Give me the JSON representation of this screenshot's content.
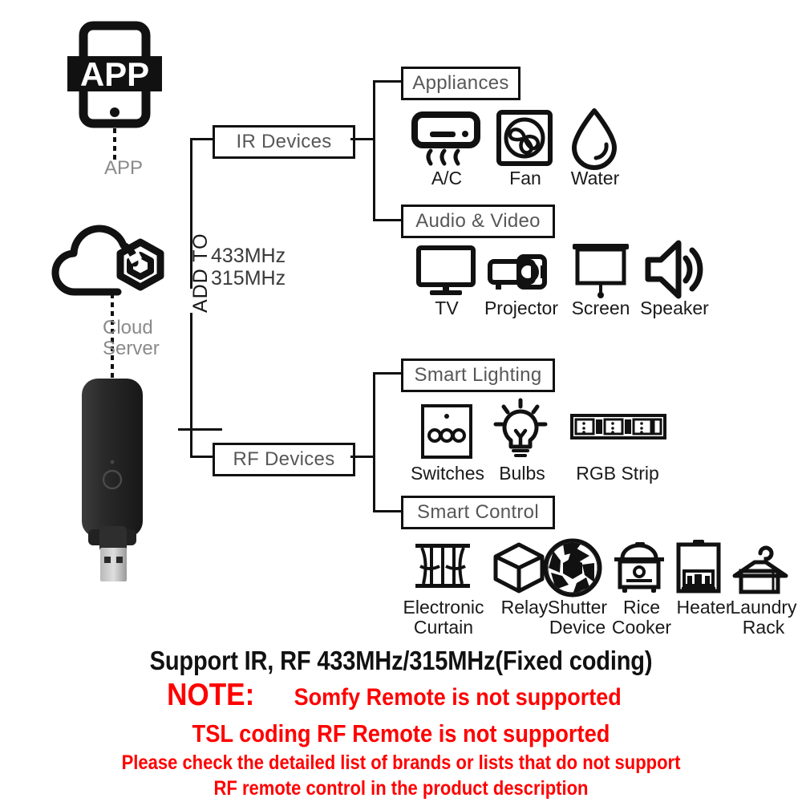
{
  "left_column": {
    "app": {
      "icon": "app-phone-icon",
      "badge": "APP",
      "caption": "APP"
    },
    "cloud": {
      "icon": "cloud-server-icon",
      "caption": "Cloud\nServer"
    },
    "dongle": {
      "icon": "usb-dongle-icon"
    }
  },
  "trunk": {
    "add_to_label": "ADD TO",
    "frequencies": "433MHz\n315MHz"
  },
  "nodes": {
    "ir_devices": "IR Devices",
    "rf_devices": "RF Devices"
  },
  "groups": [
    {
      "id": "appliances",
      "title": "Appliances",
      "items": [
        {
          "icon": "air-conditioner-icon",
          "label": "A/C"
        },
        {
          "icon": "fan-icon",
          "label": "Fan"
        },
        {
          "icon": "water-drop-icon",
          "label": "Water"
        }
      ]
    },
    {
      "id": "audio-video",
      "title": "Audio & Video",
      "items": [
        {
          "icon": "tv-icon",
          "label": "TV"
        },
        {
          "icon": "projector-icon",
          "label": "Projector"
        },
        {
          "icon": "projection-screen-icon",
          "label": "Screen"
        },
        {
          "icon": "speaker-icon",
          "label": "Speaker"
        }
      ]
    },
    {
      "id": "smart-lighting",
      "title": "Smart Lighting",
      "items": [
        {
          "icon": "wall-switch-icon",
          "label": "Switches"
        },
        {
          "icon": "light-bulb-icon",
          "label": "Bulbs"
        },
        {
          "icon": "rgb-led-strip-icon",
          "label": "RGB Strip"
        }
      ]
    },
    {
      "id": "smart-control",
      "title": "Smart Control",
      "items": [
        {
          "icon": "curtain-icon",
          "label": "Electronic\nCurtain"
        },
        {
          "icon": "relay-cube-icon",
          "label": "Relay"
        },
        {
          "icon": "shutter-aperture-icon",
          "label": "Shutter\nDevice"
        },
        {
          "icon": "rice-cooker-icon",
          "label": "Rice\nCooker"
        },
        {
          "icon": "water-heater-icon",
          "label": "Heater"
        },
        {
          "icon": "laundry-rack-icon",
          "label": "Laundry\nRack"
        }
      ]
    }
  ],
  "footer": {
    "support_line": "Support IR, RF 433MHz/315MHz(Fixed coding)",
    "note_prefix": "NOTE:",
    "note_line1": "Somfy Remote is not supported",
    "note_line2": "TSL coding RF Remote is not supported",
    "note_line3": "Please check the detailed list of brands or lists that do not support\nRF remote control in the product description"
  },
  "colors": {
    "line": "#111111",
    "box_text": "#575757",
    "note_red": "#FF0000",
    "icon_black": "#1A1A1A",
    "dongle_body": "#2B2B2B"
  }
}
